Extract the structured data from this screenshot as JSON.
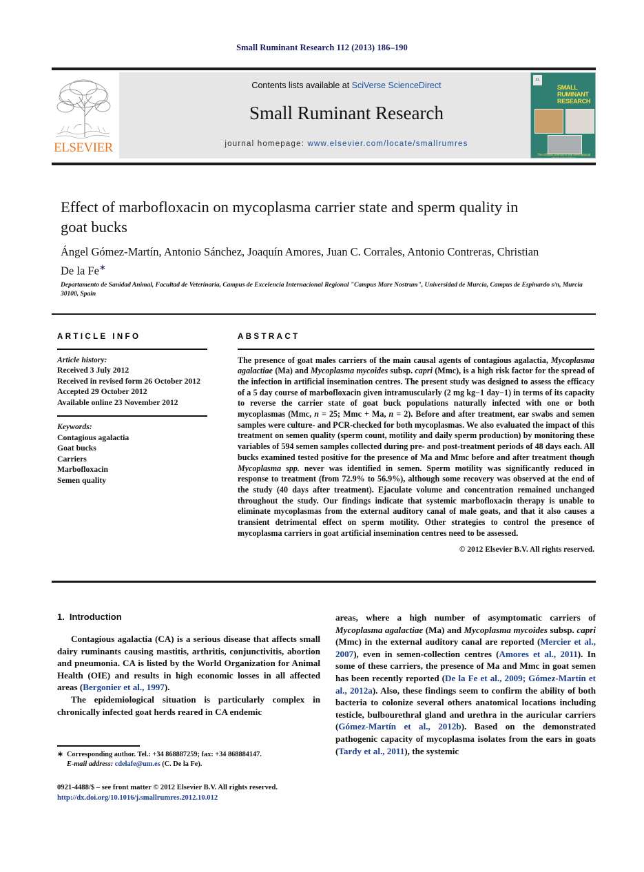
{
  "running_head": "Small Ruminant Research 112 (2013) 186–190",
  "masthead": {
    "publisher_name": "ELSEVIER",
    "contents_prefix": "Contents lists available at ",
    "contents_link": "SciVerse ScienceDirect",
    "journal_title": "Small Ruminant Research",
    "homepage_prefix": "journal homepage: ",
    "homepage_url": "www.elsevier.com/locate/smallrumres",
    "cover": {
      "title_line1": "SMALL",
      "title_line2": "RUMINANT",
      "title_line3": "RESEARCH",
      "imprint": "EL",
      "footer": "The Official Journal of the International Goat Association"
    }
  },
  "article": {
    "title": "Effect of marbofloxacin on mycoplasma carrier state and sperm quality in goat bucks",
    "authors": "Ángel Gómez-Martín, Antonio Sánchez, Joaquín Amores, Juan C. Corrales, Antonio Contreras, Christian De la Fe",
    "corresponding_marker": "∗",
    "affiliation": "Departamento de Sanidad Animal, Facultad de Veterinaria, Campus de Excelencia Internacional Regional \"Campus Mare Nostrum\", Universidad de Murcia, Campus de Espinardo s/n, Murcia 30100, Spain"
  },
  "article_info": {
    "heading": "ARTICLE INFO",
    "history_label": "Article history:",
    "history": [
      "Received 3 July 2012",
      "Received in revised form 26 October 2012",
      "Accepted 29 October 2012",
      "Available online 23 November 2012"
    ],
    "keywords_label": "Keywords:",
    "keywords": [
      "Contagious agalactia",
      "Goat bucks",
      "Carriers",
      "Marbofloxacin",
      "Semen quality"
    ]
  },
  "abstract": {
    "heading": "ABSTRACT",
    "paragraphs": [
      "The presence of goat males carriers of the main causal agents of contagious agalactia, Mycoplasma agalactiae (Ma) and Mycoplasma mycoides subsp. capri (Mmc), is a high risk factor for the spread of the infection in artificial insemination centres. The present study was designed to assess the efficacy of a 5 day course of marbofloxacin given intramuscularly (2 mg kg−1 day−1) in terms of its capacity to reverse the carrier state of goat buck populations naturally infected with one or both mycoplasmas (Mmc, n = 25; Mmc + Ma, n = 2). Before and after treatment, ear swabs and semen samples were culture- and PCR-checked for both mycoplasmas. We also evaluated the impact of this treatment on semen quality (sperm count, motility and daily sperm production) by monitoring these variables of 594 semen samples collected during pre- and post-treatment periods of 48 days each. All bucks examined tested positive for the presence of Ma and Mmc before and after treatment though Mycoplasma spp. never was identified in semen. Sperm motility was significantly reduced in response to treatment (from 72.9% to 56.9%), although some recovery was observed at the end of the study (40 days after treatment). Ejaculate volume and concentration remained unchanged throughout the study. Our findings indicate that systemic marbofloxacin therapy is unable to eliminate mycoplasmas from the external auditory canal of male goats, and that it also causes a transient detrimental effect on sperm motility. Other strategies to control the presence of mycoplasma carriers in goat artificial insemination centres need to be assessed."
    ],
    "copyright": "© 2012 Elsevier B.V. All rights reserved."
  },
  "body": {
    "section_number": "1.",
    "section_title": "Introduction",
    "left_paragraph_1": "Contagious agalactia (CA) is a serious disease that affects small dairy ruminants causing mastitis, arthritis, conjunctivitis, abortion and pneumonia. CA is listed by the World Organization for Animal Health (OIE) and results in high economic losses in all affected areas (Bergonier et al., 1997).",
    "left_paragraph_1_ref": "Bergonier et al., 1997",
    "left_paragraph_2": "The epidemiological situation is particularly complex in chronically infected goat herds reared in CA endemic",
    "right_paragraph": "areas, where a high number of asymptomatic carriers of Mycoplasma agalactiae (Ma) and Mycoplasma mycoides subsp. capri (Mmc) in the external auditory canal are reported (Mercier et al., 2007), even in semen-collection centres (Amores et al., 2011). In some of these carriers, the presence of Ma and Mmc in goat semen has been recently reported (De la Fe et al., 2009; Gómez-Martín et al., 2012a). Also, these findings seem to confirm the ability of both bacteria to colonize several others anatomical locations including testicle, bulbourethral gland and urethra in the auricular carriers (Gómez-Martín et al., 2012b). Based on the demonstrated pathogenic capacity of mycoplasma isolates from the ears in goats (Tardy et al., 2011), the systemic",
    "references_right": [
      "Mercier et al., 2007",
      "Amores et al., 2011",
      "De la Fe et al., 2009; Gómez-Martín et al., 2012a",
      "Gómez-Martín et al., 2012b",
      "Tardy et al., 2011"
    ]
  },
  "footnotes": {
    "star": "∗",
    "corresponding": "Corresponding author. Tel.: +34 868887259; fax: +34 868884147.",
    "email_label": "E-mail address:",
    "email": "cdelafe@um.es",
    "email_owner": "(C. De la Fe).",
    "issn_line": "0921-4488/$ – see front matter © 2012 Elsevier B.V. All rights reserved.",
    "doi": "http://dx.doi.org/10.1016/j.smallrumres.2012.10.012"
  },
  "colors": {
    "link": "#1a3e8c",
    "runhead": "#1b1b63",
    "elsevier_orange": "#e87722",
    "cover_green": "#2f7f73"
  }
}
